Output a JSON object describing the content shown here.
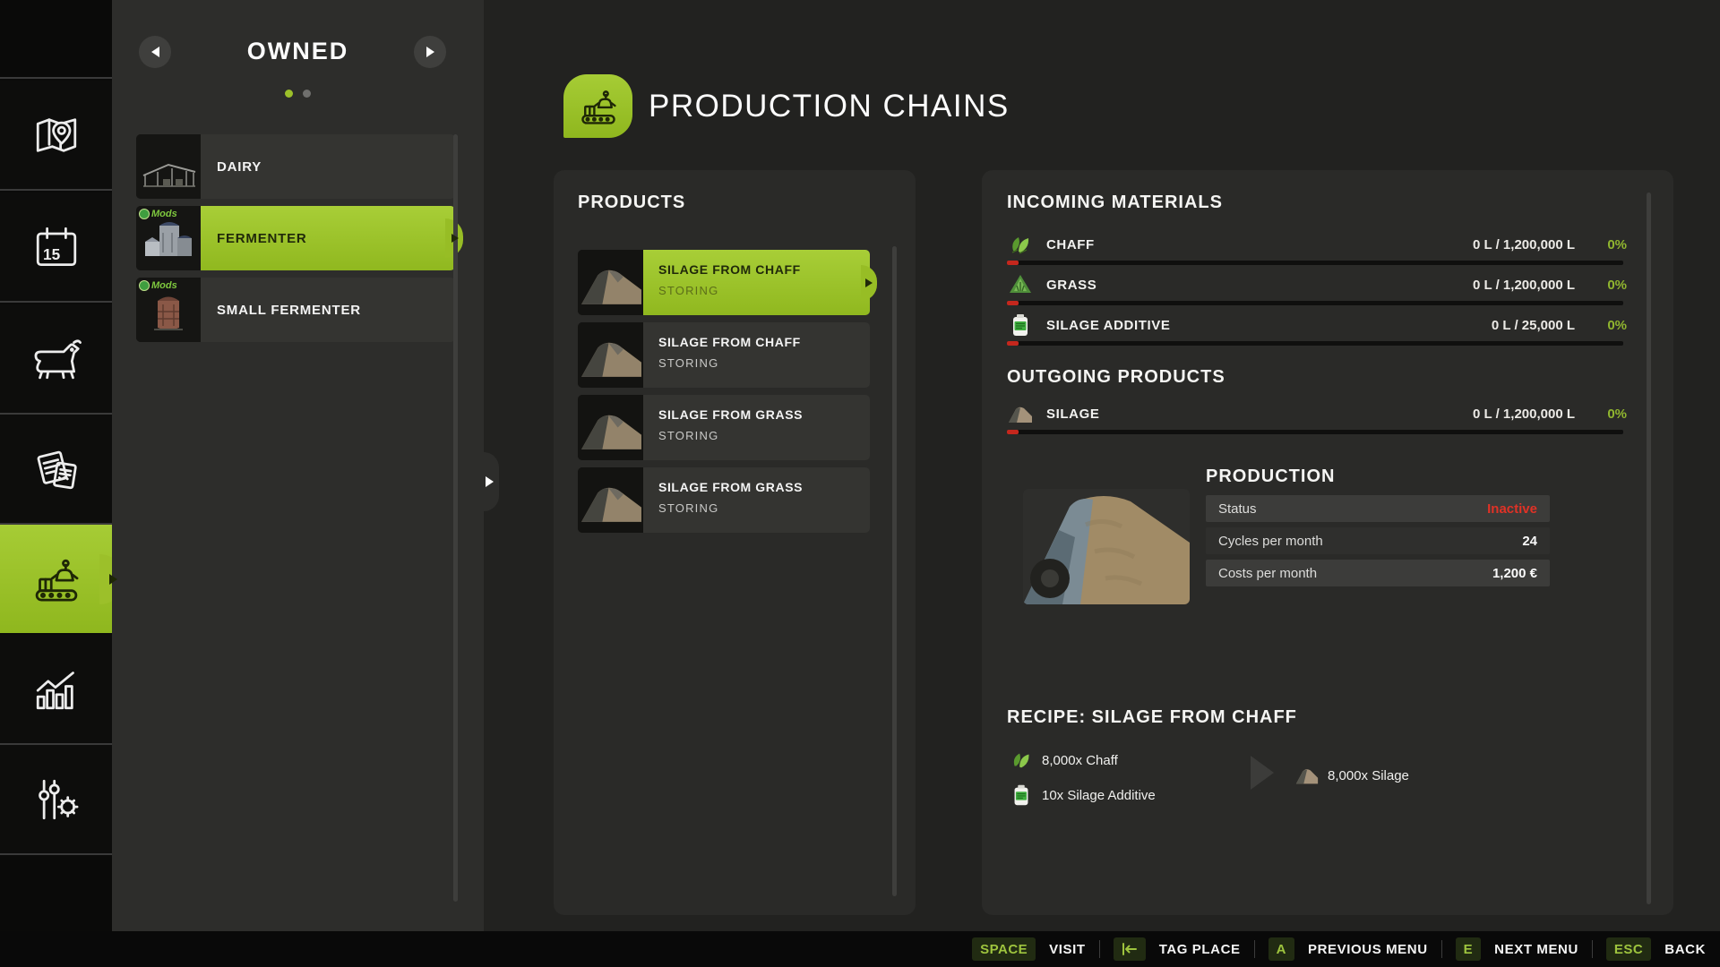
{
  "colors": {
    "accent": "#9cc02a",
    "accent_text": "#20290a",
    "red": "#e03226",
    "percent_green": "#90b52f",
    "panel": "#2a2a28"
  },
  "sidebar": {
    "items": [
      {
        "name": "map",
        "icon": "map-icon"
      },
      {
        "name": "calendar",
        "icon": "calendar-icon",
        "day": "15"
      },
      {
        "name": "animals",
        "icon": "cow-icon"
      },
      {
        "name": "contracts",
        "icon": "contracts-icon"
      },
      {
        "name": "production",
        "icon": "production-icon",
        "active": true
      },
      {
        "name": "statistics",
        "icon": "stats-icon"
      },
      {
        "name": "settings",
        "icon": "tuning-icon"
      }
    ]
  },
  "owned_panel": {
    "title": "OWNED",
    "pages": {
      "count": 2,
      "active": 0
    },
    "items": [
      {
        "label": "DAIRY",
        "selected": false,
        "badge": ""
      },
      {
        "label": "FERMENTER",
        "selected": true,
        "badge": "Mods"
      },
      {
        "label": "SMALL FERMENTER",
        "selected": false,
        "badge": "Mods"
      }
    ]
  },
  "header": {
    "title": "PRODUCTION CHAINS",
    "icon": "production-chains-icon"
  },
  "products_panel": {
    "title": "PRODUCTS",
    "items": [
      {
        "title": "SILAGE FROM CHAFF",
        "status": "STORING",
        "selected": true
      },
      {
        "title": "SILAGE FROM CHAFF",
        "status": "STORING",
        "selected": false
      },
      {
        "title": "SILAGE FROM GRASS",
        "status": "STORING",
        "selected": false
      },
      {
        "title": "SILAGE FROM GRASS",
        "status": "STORING",
        "selected": false
      }
    ]
  },
  "details": {
    "incoming": {
      "title": "INCOMING MATERIALS",
      "rows": [
        {
          "name": "CHAFF",
          "icon": "chaff-icon",
          "amount": "0 L / 1,200,000 L",
          "percent": "0%",
          "fill_percent": 0
        },
        {
          "name": "GRASS",
          "icon": "grass-icon",
          "amount": "0 L / 1,200,000 L",
          "percent": "0%",
          "fill_percent": 0
        },
        {
          "name": "SILAGE ADDITIVE",
          "icon": "silage-additive-icon",
          "amount": "0 L / 25,000 L",
          "percent": "0%",
          "fill_percent": 0
        }
      ]
    },
    "outgoing": {
      "title": "OUTGOING PRODUCTS",
      "rows": [
        {
          "name": "SILAGE",
          "icon": "silage-icon",
          "amount": "0 L / 1,200,000 L",
          "percent": "0%",
          "fill_percent": 0
        }
      ]
    },
    "production": {
      "title": "PRODUCTION",
      "rows": [
        {
          "label": "Status",
          "value": "Inactive"
        },
        {
          "label": "Cycles per month",
          "value": "24"
        },
        {
          "label": "Costs per month",
          "value": "1,200 €"
        }
      ]
    },
    "recipe": {
      "title": "RECIPE: SILAGE FROM CHAFF",
      "inputs": [
        {
          "qty": "8,000x Chaff",
          "icon": "chaff-icon"
        },
        {
          "qty": "10x Silage Additive",
          "icon": "silage-additive-icon"
        }
      ],
      "outputs": [
        {
          "qty": "8,000x Silage",
          "icon": "silage-icon"
        }
      ]
    }
  },
  "bottom_bar": {
    "hints": [
      {
        "key": "SPACE",
        "label": "VISIT"
      },
      {
        "key": "",
        "key_icon": "tab-icon",
        "label": "TAG PLACE"
      },
      {
        "key": "A",
        "label": "PREVIOUS MENU"
      },
      {
        "key": "E",
        "label": "NEXT MENU"
      },
      {
        "key": "ESC",
        "label": "BACK"
      }
    ]
  }
}
